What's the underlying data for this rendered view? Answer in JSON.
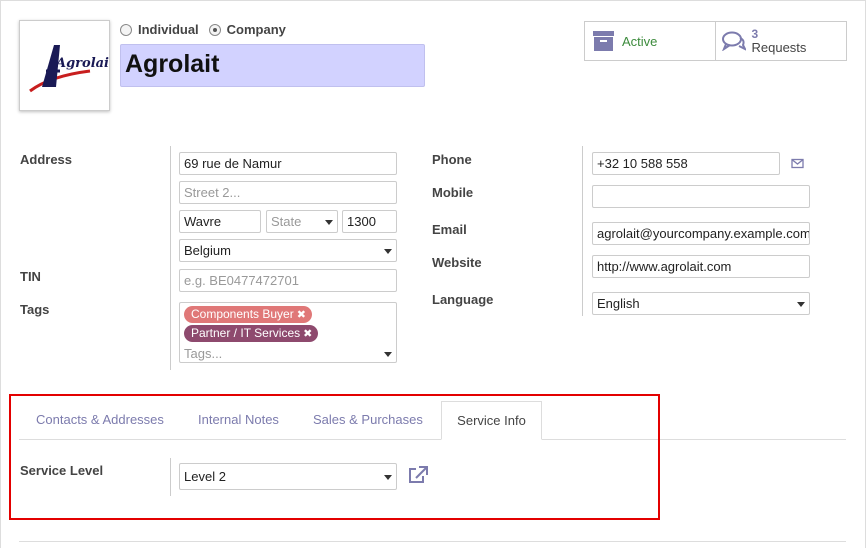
{
  "company_type": {
    "individual_label": "Individual",
    "company_label": "Company",
    "selected": "company"
  },
  "partner": {
    "name": "Agrolait",
    "logo_text": "Agrolait"
  },
  "smart_buttons": {
    "active_label": "Active",
    "requests_count": "3",
    "requests_label": "Requests",
    "active_color": "#3c8b3c",
    "accent_color": "#7c7bad"
  },
  "address": {
    "label": "Address",
    "street": "69 rue de Namur",
    "street2_placeholder": "Street 2...",
    "city": "Wavre",
    "state_placeholder": "State",
    "zip": "1300",
    "country": "Belgium"
  },
  "tin": {
    "label": "TIN",
    "placeholder": "e.g. BE0477472701"
  },
  "tags": {
    "label": "Tags",
    "items": [
      {
        "label": "Components Buyer",
        "color": "#e07878"
      },
      {
        "label": "Partner / IT Services",
        "color": "#8e4a6e"
      }
    ],
    "placeholder": "Tags..."
  },
  "contact": {
    "phone_label": "Phone",
    "phone": "+32 10 588 558",
    "mobile_label": "Mobile",
    "mobile": "",
    "email_label": "Email",
    "email": "agrolait@yourcompany.example.com",
    "website_label": "Website",
    "website": "http://www.agrolait.com",
    "language_label": "Language",
    "language": "English"
  },
  "tabs": [
    {
      "label": "Contacts & Addresses",
      "active": false
    },
    {
      "label": "Internal Notes",
      "active": false
    },
    {
      "label": "Sales & Purchases",
      "active": false
    },
    {
      "label": "Service Info",
      "active": true
    }
  ],
  "service_info": {
    "service_level_label": "Service Level",
    "service_level": "Level 2"
  },
  "highlight_color": "#e30000"
}
